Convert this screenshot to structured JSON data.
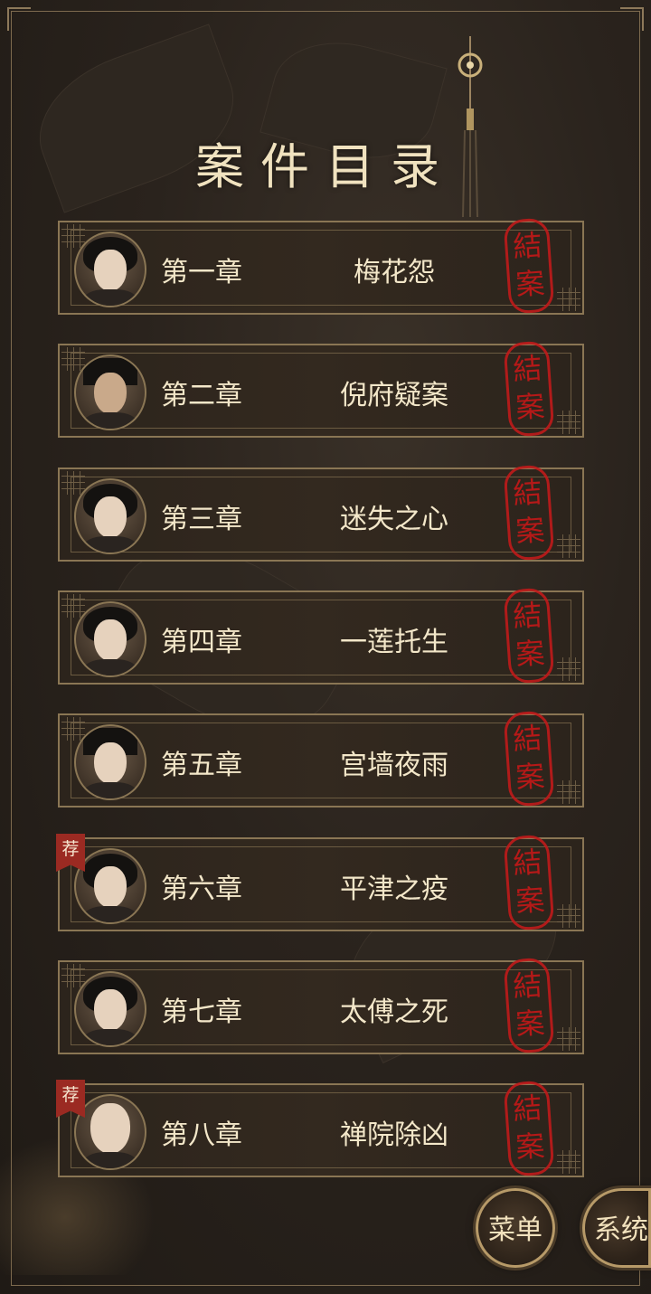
{
  "title": "案件目录",
  "stamp_chars": [
    "結",
    "案"
  ],
  "recommend_badge": "荐",
  "chapters": [
    {
      "number": "第一章",
      "name": "梅花怨",
      "recommended": false
    },
    {
      "number": "第二章",
      "name": "倪府疑案",
      "recommended": false
    },
    {
      "number": "第三章",
      "name": "迷失之心",
      "recommended": false
    },
    {
      "number": "第四章",
      "name": "一莲托生",
      "recommended": false
    },
    {
      "number": "第五章",
      "name": "宫墙夜雨",
      "recommended": false
    },
    {
      "number": "第六章",
      "name": "平津之疫",
      "recommended": true
    },
    {
      "number": "第七章",
      "name": "太傅之死",
      "recommended": false
    },
    {
      "number": "第八章",
      "name": "禅院除凶",
      "recommended": true
    }
  ],
  "buttons": {
    "menu": "菜单",
    "system": "系统"
  },
  "colors": {
    "accent": "#f3e7c9",
    "stamp": "#c41818",
    "frame": "#8a7654",
    "badge": "#9b2a22"
  }
}
